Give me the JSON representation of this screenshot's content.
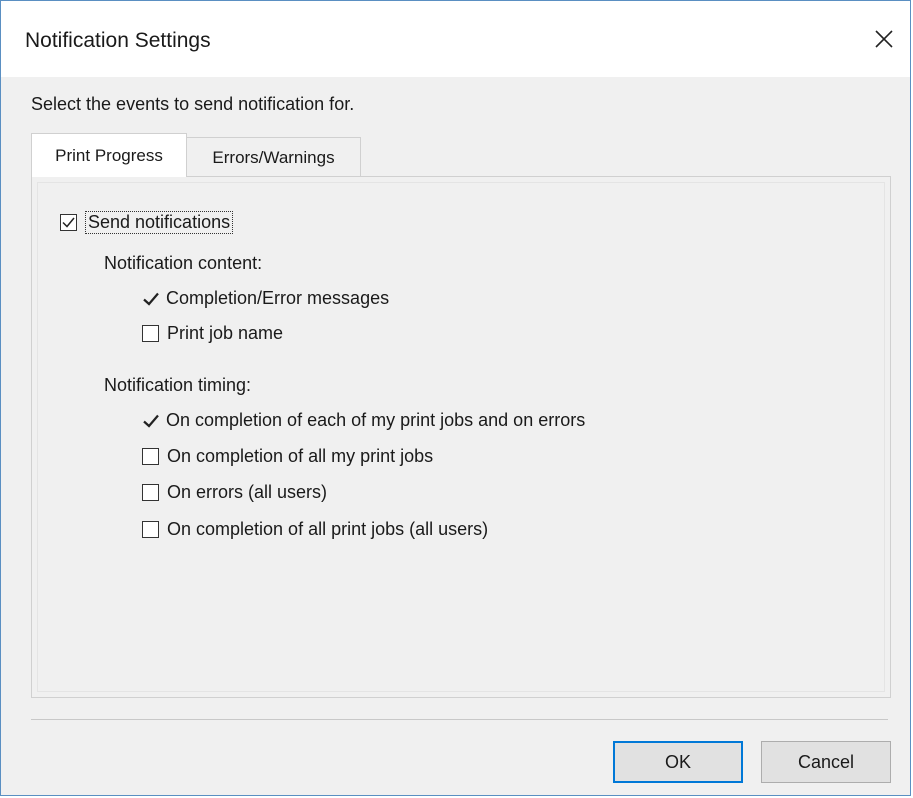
{
  "window": {
    "title": "Notification Settings"
  },
  "prompt": "Select the events to send notification for.",
  "tabs": [
    {
      "label": "Print Progress",
      "active": true
    },
    {
      "label": "Errors/Warnings",
      "active": false
    }
  ],
  "send_notifications": {
    "label": "Send notifications",
    "checked": true
  },
  "content": {
    "heading": "Notification content:",
    "items": [
      {
        "label": "Completion/Error messages",
        "state": "fixed-checked"
      },
      {
        "label": "Print job name",
        "state": "unchecked"
      }
    ]
  },
  "timing": {
    "heading": "Notification timing:",
    "items": [
      {
        "label": "On completion of each of my print jobs and on errors",
        "state": "fixed-checked"
      },
      {
        "label": "On completion of all my print jobs",
        "state": "unchecked"
      },
      {
        "label": "On errors (all users)",
        "state": "unchecked"
      },
      {
        "label": "On completion of all print jobs (all users)",
        "state": "unchecked"
      }
    ]
  },
  "buttons": {
    "ok": "OK",
    "cancel": "Cancel"
  },
  "icons": {
    "close": "close-icon",
    "check": "checkmark-icon"
  },
  "colors": {
    "accent": "#0078d7",
    "window_border": "#5a8fc2",
    "face": "#f0f0f0"
  }
}
